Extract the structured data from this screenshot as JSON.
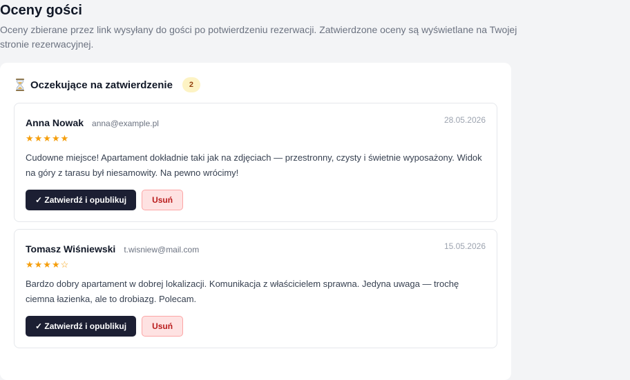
{
  "header": {
    "title": "Oceny gości",
    "description": "Oceny zbierane przez link wysyłany do gości po potwierdzeniu rezerwacji. Zatwierdzone oceny są wyświetlane na Twojej stronie rezerwacyjnej."
  },
  "pending": {
    "icon": "hourglass-icon",
    "title": "Oczekujące na zatwierdzenie",
    "count": "2",
    "reviews": [
      {
        "name": "Anna Nowak",
        "email": "anna@example.pl",
        "date": "28.05.2026",
        "rating": 5,
        "stars": "★★★★★",
        "text": "Cudowne miejsce! Apartament dokładnie taki jak na zdjęciach — przestronny, czysty i świetnie wyposażony. Widok na góry z tarasu był niesamowity. Na pewno wrócimy!",
        "approve_label": "✓ Zatwierdź i opublikuj",
        "delete_label": "Usuń"
      },
      {
        "name": "Tomasz Wiśniewski",
        "email": "t.wisniew@mail.com",
        "date": "15.05.2026",
        "rating": 4,
        "stars": "★★★★☆",
        "text": "Bardzo dobry apartament w dobrej lokalizacji. Komunikacja z właścicielem sprawna. Jedyna uwaga — trochę ciemna łazienka, ale to drobiazg. Polecam.",
        "approve_label": "✓ Zatwierdź i opublikuj",
        "delete_label": "Usuń"
      }
    ]
  },
  "colors": {
    "primary_button": "#1c1f33",
    "danger_text": "#b91c1c",
    "star": "#f59e0b",
    "badge_bg": "#fdf3c4"
  }
}
